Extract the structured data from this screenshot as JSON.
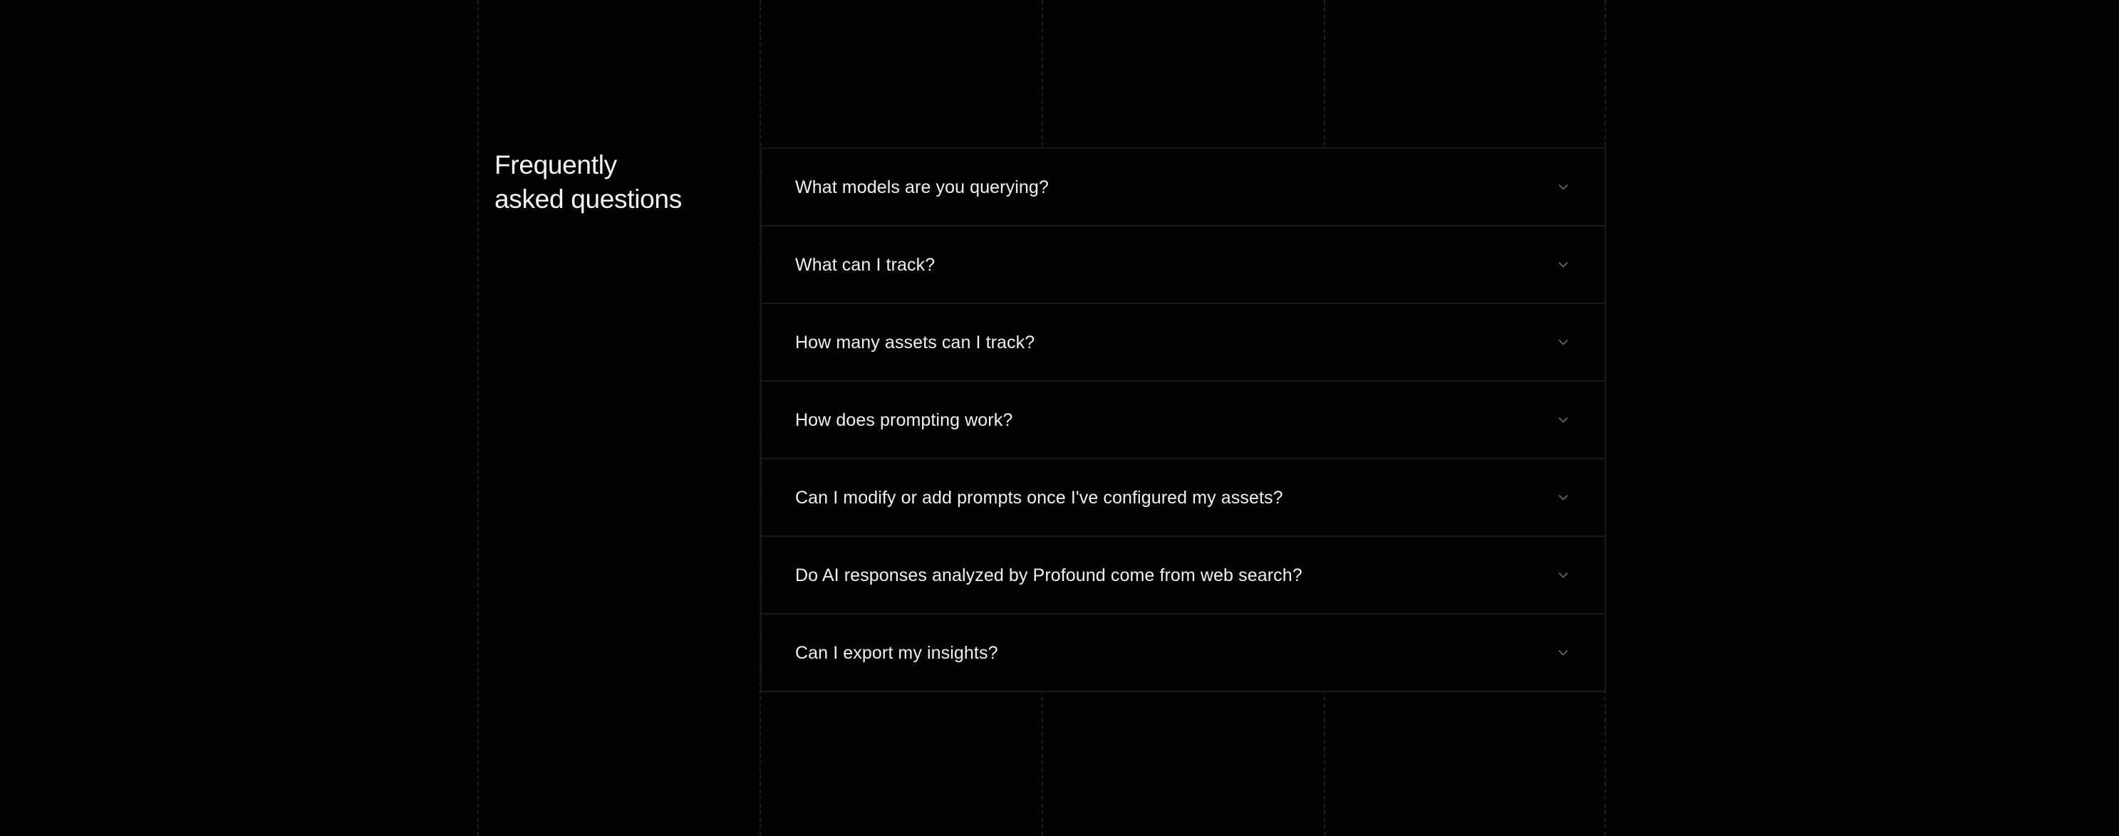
{
  "faq": {
    "heading_line1": "Frequently",
    "heading_line2": "asked questions",
    "items": [
      {
        "question": "What models are you querying?"
      },
      {
        "question": "What can I track?"
      },
      {
        "question": "How many assets can I track?"
      },
      {
        "question": "How does prompting work?"
      },
      {
        "question": "Can I modify or add prompts once I've configured my assets?"
      },
      {
        "question": "Do AI responses analyzed by Profound come from web search?"
      },
      {
        "question": "Can I export my insights?"
      }
    ],
    "icon": "chevron-down-icon"
  },
  "colors": {
    "background": "#030303",
    "text": "#f0f0f0",
    "border": "#191919",
    "icon": "#6a6a6a"
  }
}
